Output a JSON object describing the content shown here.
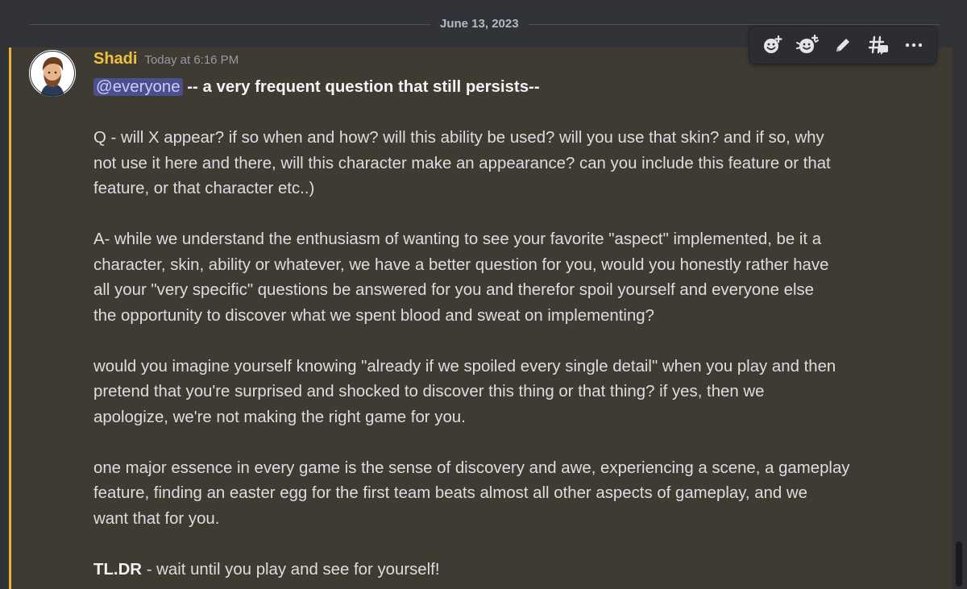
{
  "date_divider": {
    "label": "June 13, 2023"
  },
  "message": {
    "author": "Shadi",
    "timestamp": "Today at 6:16 PM",
    "mention": "@everyone",
    "headline": "-- a very frequent question that still persists--",
    "q_line_1": "Q - will X appear? if so when and how? will this ability be used? will you use that skin? and if so, why",
    "q_line_2": "not use it here and there, will this character make an appearance? can you include this feature or that",
    "q_line_3": "feature, or that character etc..)",
    "a_line_1": "A- while we understand the enthusiasm of wanting to see your favorite \"aspect\" implemented, be it a",
    "a_line_2": "character, skin, ability or whatever, we have a better question for you, would you honestly rather have",
    "a_line_3": "all your \"very specific\" questions be answered for you and therefor spoil yourself and everyone else",
    "a_line_4": "the opportunity to discover what we spent blood and sweat on implementing?",
    "b_line_1": "would you imagine yourself knowing \"already if we spoiled every single detail\" when you play and then",
    "b_line_2": "pretend that you're surprised and shocked to discover this thing or that thing? if yes, then we",
    "b_line_3": "apologize, we're not making the right game for you.",
    "c_line_1": "one major essence in every game is the sense of discovery and awe, experiencing a scene, a gameplay",
    "c_line_2": "feature, finding an easter egg for the first team beats almost all other aspects of gameplay, and we",
    "c_line_3": "want that for you.",
    "tldr_label": "TL.DR",
    "tldr_text": " - wait until you play and see for yourself!"
  },
  "toolbar": {
    "icons": [
      "add-reaction-icon",
      "super-reaction-icon",
      "edit-icon",
      "create-thread-icon",
      "more-icon"
    ]
  },
  "colors": {
    "background": "#313338",
    "mention_highlight_bg": "#3f3b33",
    "mention_highlight_border": "#f0b232",
    "username": "#f0c13e",
    "mention_pill": "#4b4f8c"
  }
}
